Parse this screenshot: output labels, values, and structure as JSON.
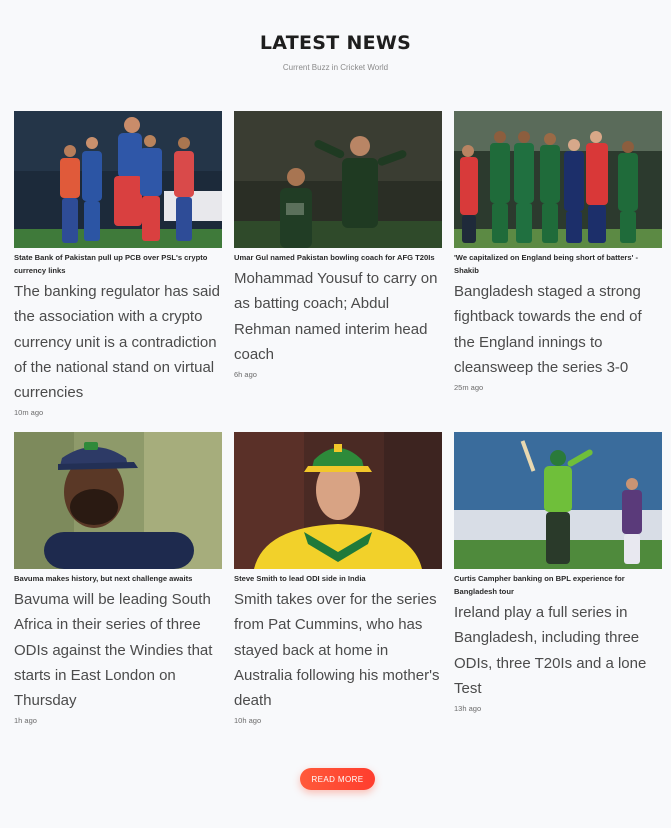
{
  "header": {
    "title": "LATEST NEWS",
    "subtitle": "Current Buzz in Cricket World"
  },
  "articles": [
    {
      "headline": "State Bank of Pakistan pull up PCB over PSL's crypto currency links",
      "description": "The banking regulator has said the association with a crypto currency unit is a contradiction of the national stand on virtual currencies",
      "time": "10m ago",
      "image": "karachi-kings-celebration-photo"
    },
    {
      "headline": "Umar Gul named Pakistan bowling coach for AFG T20Is",
      "description": "Mohammad Yousuf to carry on as batting coach; Abdul Rehman named interim head coach",
      "time": "6h ago",
      "image": "pakistan-bowler-celebration-photo"
    },
    {
      "headline": "'We capitalized on England being short of batters' - Shakib",
      "description": "Bangladesh staged a strong fightback towards the end of the England innings to cleansweep the series 3-0",
      "time": "25m ago",
      "image": "bangladesh-team-huddle-photo"
    },
    {
      "headline": "Bavuma makes history, but next challenge awaits",
      "description": "Bavuma will be leading South Africa in their series of three ODIs against the Windies that starts in East London on Thursday",
      "time": "1h ago",
      "image": "bavuma-portrait-photo"
    },
    {
      "headline": "Steve Smith to lead ODI side in India",
      "description": "Smith takes over for the series from Pat Cummins, who has stayed back at home in Australia following his mother's death",
      "time": "10h ago",
      "image": "steve-smith-portrait-photo"
    },
    {
      "headline": "Curtis Campher banking on BPL experience for Bangladesh tour",
      "description": "Ireland play a full series in Bangladesh, including three ODIs, three T20Is and a lone Test",
      "time": "13h ago",
      "image": "ireland-batter-photo"
    }
  ],
  "footer": {
    "read_more_label": "READ MORE"
  },
  "colors": {
    "accent": "#ff4a33",
    "background": "#f8f9fb",
    "title": "#1e1e1e"
  }
}
